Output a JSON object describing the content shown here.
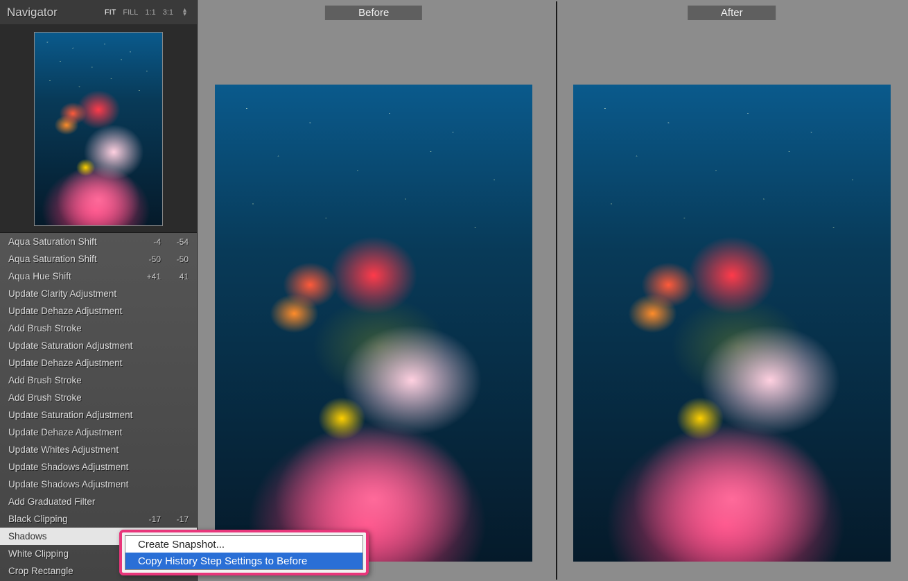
{
  "navigator": {
    "title": "Navigator",
    "zoom": [
      "FIT",
      "FILL",
      "1:1",
      "3:1"
    ],
    "active_zoom": 0
  },
  "history": [
    {
      "label": "Aqua Saturation Shift",
      "v1": "-4",
      "v2": "-54"
    },
    {
      "label": "Aqua Saturation Shift",
      "v1": "-50",
      "v2": "-50"
    },
    {
      "label": "Aqua Hue Shift",
      "v1": "+41",
      "v2": "41"
    },
    {
      "label": "Update Clarity Adjustment"
    },
    {
      "label": "Update Dehaze Adjustment"
    },
    {
      "label": "Add Brush Stroke"
    },
    {
      "label": "Update Saturation Adjustment"
    },
    {
      "label": "Update Dehaze Adjustment"
    },
    {
      "label": "Add Brush Stroke"
    },
    {
      "label": "Add Brush Stroke"
    },
    {
      "label": "Update Saturation Adjustment"
    },
    {
      "label": "Update Dehaze Adjustment"
    },
    {
      "label": "Update Whites Adjustment"
    },
    {
      "label": "Update Shadows Adjustment"
    },
    {
      "label": "Update Shadows Adjustment"
    },
    {
      "label": "Add Graduated Filter"
    },
    {
      "label": "Black Clipping",
      "v1": "-17",
      "v2": "-17"
    },
    {
      "label": "Shadows",
      "selected": true
    },
    {
      "label": "White Clipping"
    },
    {
      "label": "Crop Rectangle"
    }
  ],
  "compare": {
    "before": "Before",
    "after": "After"
  },
  "context_menu": {
    "items": [
      {
        "label": "Create Snapshot..."
      },
      {
        "label": "Copy History Step Settings to Before",
        "highlight": true
      }
    ]
  }
}
